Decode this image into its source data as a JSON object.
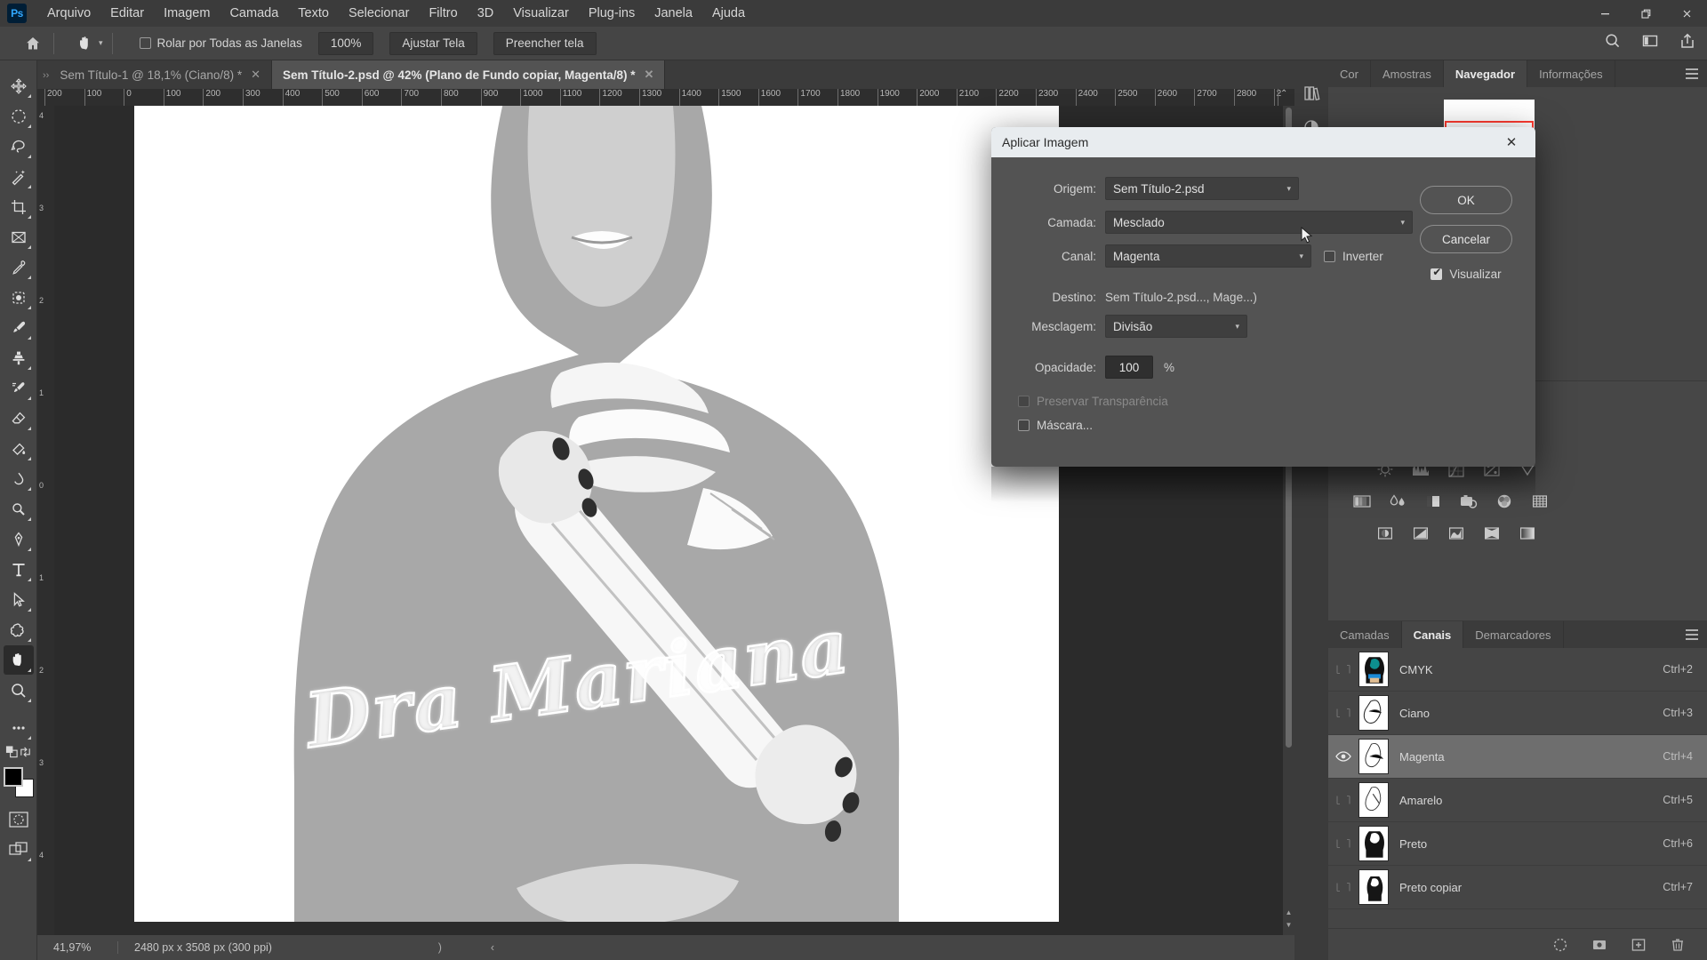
{
  "app": {
    "logo": "Ps"
  },
  "menubar": {
    "items": [
      "Arquivo",
      "Editar",
      "Imagem",
      "Camada",
      "Texto",
      "Selecionar",
      "Filtro",
      "3D",
      "Visualizar",
      "Plug-ins",
      "Janela",
      "Ajuda"
    ],
    "window_controls": [
      {
        "name": "minimize",
        "glyph": "—"
      },
      {
        "name": "restore",
        "glyph": "❐"
      },
      {
        "name": "close",
        "glyph": "✕"
      }
    ]
  },
  "optionsbar": {
    "home_icon": "home-icon",
    "tool_icon": "hand-tool-icon",
    "scroll_all_windows_label": "Rolar por Todas as Janelas",
    "scroll_all_windows_checked": false,
    "zoom_100_label": "100%",
    "fit_screen_label": "Ajustar Tela",
    "fill_screen_label": "Preencher tela",
    "right_icons": [
      "search-icon",
      "workspace-icon",
      "share-icon"
    ]
  },
  "toolbar": {
    "tools": [
      {
        "name": "move-tool",
        "selected": false
      },
      {
        "name": "elliptical-marquee-tool",
        "selected": false
      },
      {
        "name": "lasso-tool",
        "selected": false
      },
      {
        "name": "magic-wand-tool",
        "selected": false
      },
      {
        "name": "crop-tool",
        "selected": false
      },
      {
        "name": "frame-tool",
        "selected": false
      },
      {
        "name": "eyedropper-tool",
        "selected": false
      },
      {
        "name": "spot-healing-brush-tool",
        "selected": false
      },
      {
        "name": "brush-tool",
        "selected": false
      },
      {
        "name": "clone-stamp-tool",
        "selected": false
      },
      {
        "name": "history-brush-tool",
        "selected": false
      },
      {
        "name": "eraser-tool",
        "selected": false
      },
      {
        "name": "gradient-tool",
        "selected": false
      },
      {
        "name": "blur-tool",
        "selected": false
      },
      {
        "name": "dodge-tool",
        "selected": false
      },
      {
        "name": "pen-tool",
        "selected": false
      },
      {
        "name": "type-tool",
        "selected": false
      },
      {
        "name": "path-selection-tool",
        "selected": false
      },
      {
        "name": "shape-tool",
        "selected": false
      },
      {
        "name": "hand-tool",
        "selected": true
      },
      {
        "name": "zoom-tool",
        "selected": false
      },
      {
        "name": "edit-toolbar-tool",
        "selected": false
      }
    ],
    "foreground_color": "#000000",
    "background_color": "#ffffff"
  },
  "tabs": [
    {
      "label": "Sem Título-1 @ 18,1% (Ciano/8) *",
      "active": false
    },
    {
      "label": "Sem Título-2.psd @ 42% (Plano de Fundo copiar, Magenta/8) *",
      "active": true
    }
  ],
  "rulers": {
    "horizontal": [
      "200",
      "100",
      "0",
      "100",
      "200",
      "300",
      "400",
      "500",
      "600",
      "700",
      "800",
      "900",
      "1000",
      "1100",
      "1200",
      "1300",
      "1400",
      "1500",
      "1600",
      "1700",
      "1800",
      "1900",
      "2000",
      "2100",
      "2200",
      "2300",
      "2400",
      "2500",
      "2600",
      "2700",
      "2800",
      "2"
    ],
    "vertical": [
      "4",
      "3",
      "2",
      "1",
      "0",
      "1",
      "2",
      "3",
      "4"
    ]
  },
  "canvas": {
    "artwork_text": "Dra Mariana"
  },
  "statusbar": {
    "zoom": "41,97%",
    "dimensions": "2480 px x 3508 px (300 ppi)",
    "nav_right": ")",
    "nav_left": "‹"
  },
  "dialog": {
    "title": "Aplicar Imagem",
    "close_glyph": "✕",
    "fields": {
      "origem_label": "Origem:",
      "origem_value": "Sem Título-2.psd",
      "camada_label": "Camada:",
      "camada_value": "Mesclado",
      "canal_label": "Canal:",
      "canal_value": "Magenta",
      "inverter_label": "Inverter",
      "inverter_checked": false,
      "destino_label": "Destino:",
      "destino_value": "Sem Título-2.psd..., Mage...)",
      "mesclagem_label": "Mesclagem:",
      "mesclagem_value": "Divisão",
      "opacidade_label": "Opacidade:",
      "opacidade_value": "100",
      "opacidade_unit": "%",
      "preservar_label": "Preservar Transparência",
      "preservar_checked": false,
      "preservar_disabled": true,
      "mascara_label": "Máscara...",
      "mascara_checked": false
    },
    "buttons": {
      "ok_label": "OK",
      "cancel_label": "Cancelar",
      "preview_label": "Visualizar",
      "preview_checked": true
    }
  },
  "dock": {
    "rail_icons": [
      "libraries-icon",
      "adjustments-icon"
    ],
    "panel_tabs": [
      {
        "label": "Cor",
        "active": false
      },
      {
        "label": "Amostras",
        "active": false
      },
      {
        "label": "Navegador",
        "active": true
      },
      {
        "label": "Informações",
        "active": false
      }
    ],
    "navigator": {
      "viewbox_color": "#ff3b30"
    },
    "adjustments": {
      "row1": [
        "brightness-contrast-icon",
        "levels-icon",
        "curves-icon",
        "exposure-icon",
        "vibrance-icon"
      ],
      "row2": [
        "hue-saturation-icon",
        "color-balance-icon",
        "black-white-icon",
        "photo-filter-icon",
        "channel-mixer-icon",
        "color-lookup-icon"
      ],
      "row3": [
        "invert-icon",
        "posterize-icon",
        "threshold-icon",
        "gradient-map-icon",
        "selective-color-icon"
      ]
    },
    "channels_panel": {
      "tabs": [
        {
          "label": "Camadas",
          "active": false
        },
        {
          "label": "Canais",
          "active": true
        },
        {
          "label": "Demarcadores",
          "active": false
        }
      ],
      "channels": [
        {
          "name": "CMYK",
          "shortcut": "Ctrl+2",
          "visible": false,
          "selected": false
        },
        {
          "name": "Ciano",
          "shortcut": "Ctrl+3",
          "visible": false,
          "selected": false
        },
        {
          "name": "Magenta",
          "shortcut": "Ctrl+4",
          "visible": true,
          "selected": true
        },
        {
          "name": "Amarelo",
          "shortcut": "Ctrl+5",
          "visible": false,
          "selected": false
        },
        {
          "name": "Preto",
          "shortcut": "Ctrl+6",
          "visible": false,
          "selected": false
        },
        {
          "name": "Preto copiar",
          "shortcut": "Ctrl+7",
          "visible": false,
          "selected": false
        }
      ],
      "footer_icons": [
        "load-selection-icon",
        "save-selection-icon",
        "new-channel-icon",
        "delete-channel-icon"
      ]
    }
  }
}
